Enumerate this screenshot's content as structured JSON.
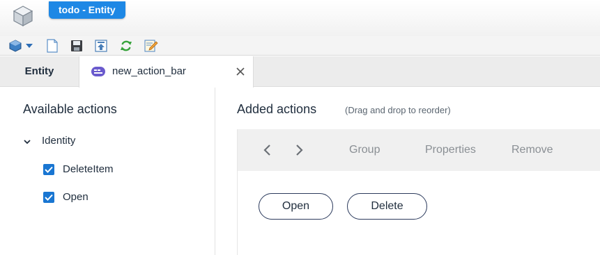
{
  "window": {
    "title": "todo - Entity"
  },
  "icons": {
    "logo": "cube-logo-icon",
    "toolbar": [
      "entity-menu-icon",
      "dropdown-arrow-icon",
      "new-document-icon",
      "save-icon",
      "export-icon",
      "refresh-icon",
      "edit-icon"
    ]
  },
  "tabs": [
    {
      "label": "Entity"
    },
    {
      "label": "new_action_bar"
    }
  ],
  "left_panel": {
    "title": "Available actions",
    "group": {
      "label": "Identity",
      "expanded": true
    },
    "items": [
      {
        "label": "DeleteItem",
        "checked": true
      },
      {
        "label": "Open",
        "checked": true
      }
    ]
  },
  "right_panel": {
    "title": "Added actions",
    "hint": "(Drag and drop to reorder)",
    "toolbar": {
      "group": "Group",
      "properties": "Properties",
      "remove": "Remove"
    },
    "actions": [
      {
        "label": "Open"
      },
      {
        "label": "Delete"
      }
    ]
  },
  "colors": {
    "accent": "#1e88e5",
    "checkbox": "#1976d2",
    "pill_border": "#2b3a5c"
  }
}
